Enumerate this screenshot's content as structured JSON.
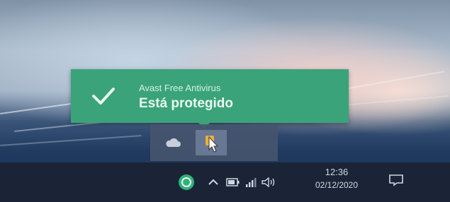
{
  "toast": {
    "title": "Avast Free Antivirus",
    "message": "Está protegido",
    "icon": "checkmark-icon",
    "color": "#3aa37a"
  },
  "tray_popup": {
    "icons": [
      "cloud-drive-icon",
      "pointer-app-icon"
    ]
  },
  "taskbar": {
    "icons": [
      "avast-icon",
      "chevron-up-icon",
      "battery-icon",
      "network-icon",
      "volume-icon",
      "notification-icon"
    ],
    "clock": {
      "time": "12:36",
      "date": "02/12/2020"
    }
  }
}
